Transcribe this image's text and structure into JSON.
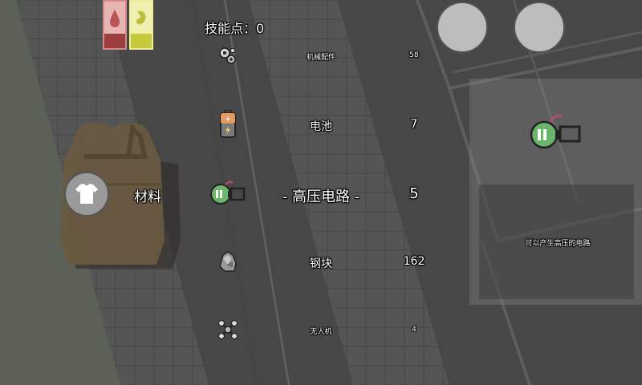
{
  "hud": {
    "skill_points_label": "技能点：0",
    "health_color": "#c96a6a",
    "energy_color": "#d8d85a"
  },
  "bag": {
    "category_label": "材料",
    "shirt_button_icon": "shirt-icon"
  },
  "inventory": [
    {
      "name": "机械配件",
      "count": "58",
      "icon": "gear-parts-icon",
      "selected": false
    },
    {
      "name": "电池",
      "count": "7",
      "icon": "battery-icon",
      "selected": false
    },
    {
      "name": "- 高压电路 -",
      "count": "5",
      "icon": "circuit-icon",
      "selected": true
    },
    {
      "name": "钢块",
      "count": "162",
      "icon": "steel-ore-icon",
      "selected": false
    },
    {
      "name": "无人机",
      "count": "4",
      "icon": "drone-icon",
      "selected": false
    }
  ],
  "detail": {
    "description": "可以产生高压的电路",
    "icon": "circuit-icon"
  },
  "top_buttons": [
    {
      "name": "round-button-left"
    },
    {
      "name": "round-button-right"
    }
  ]
}
